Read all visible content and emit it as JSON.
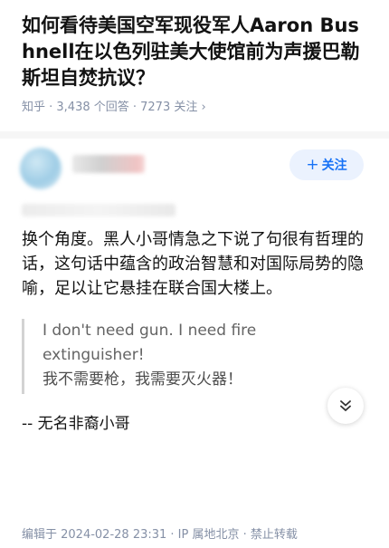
{
  "question": {
    "title": "如何看待美国空军现役军人Aaron Bushnell在以色列驻美大使馆前为声援巴勒斯坦自焚抗议？",
    "meta": "知乎 · 3,438 个回答 · 7273 关注 ›"
  },
  "author": {
    "follow_label": "关注",
    "follow_symbol": "+"
  },
  "answer": {
    "paragraph": "换个角度。黑人小哥情急之下说了句很有哲理的话，这句话中蕴含的政治智慧和对国际局势的隐喻，足以让它悬挂在联合国大楼上。",
    "quote_en": "I don't need gun. I need fire extinguisher!",
    "quote_zh": "我不需要枪，我需要灭火器！",
    "signoff": "-- 无名非裔小哥",
    "footer": "编辑于 2024-02-28 23:31 · IP 属地北京 · 禁止转载"
  },
  "colors": {
    "accent": "#1772f6",
    "meta_gray": "#8590a6",
    "quote_bar": "#d3d3d3"
  },
  "icons": {
    "collapse": "double-chevron-down-icon"
  }
}
